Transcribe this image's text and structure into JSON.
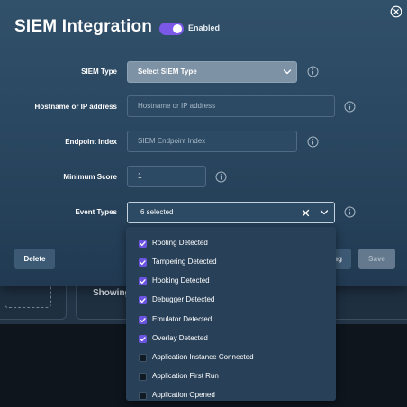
{
  "modal": {
    "title": "SIEM Integration",
    "enabled_label": "Enabled",
    "enabled": true
  },
  "form": {
    "siem_type": {
      "label": "SIEM Type",
      "value": "Select SIEM Type"
    },
    "hostname": {
      "label": "Hostname or IP address",
      "placeholder": "Hostname or IP address"
    },
    "endpoint_index": {
      "label": "Endpoint Index",
      "placeholder": "SIEM Endpoint Index"
    },
    "minimum_score": {
      "label": "Minimum Score",
      "value": "1"
    },
    "event_types": {
      "label": "Event Types",
      "value": "6 selected"
    }
  },
  "buttons": {
    "delete": "Delete",
    "cancel": "ıg",
    "save": "Save"
  },
  "event_options": [
    {
      "label": "Rooting Detected",
      "checked": true
    },
    {
      "label": "Tampering Detected",
      "checked": true
    },
    {
      "label": "Hooking Detected",
      "checked": true
    },
    {
      "label": "Debugger Detected",
      "checked": true
    },
    {
      "label": "Emulator Detected",
      "checked": true
    },
    {
      "label": "Overlay Detected",
      "checked": true
    },
    {
      "label": "Application Instance Connected",
      "checked": false
    },
    {
      "label": "Application First Run",
      "checked": false
    },
    {
      "label": "Application Opened",
      "checked": false
    }
  ],
  "background": {
    "showing_text": "Showing"
  },
  "colors": {
    "accent": "#7b58e8",
    "checkbox_on": "#6a54e0",
    "modal_bg": "#2a4761"
  },
  "icons": [
    "close-icon",
    "chevron-down-icon",
    "info-icon",
    "clear-icon",
    "check-icon"
  ]
}
